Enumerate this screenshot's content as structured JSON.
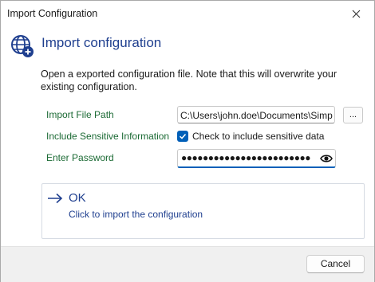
{
  "window": {
    "title": "Import Configuration"
  },
  "header": {
    "title": "Import configuration",
    "icon": "globe-import-icon"
  },
  "description": "Open a exported configuration file. Note that this will overwrite your existing configuration.",
  "form": {
    "path_label": "Import File Path",
    "path_value": "C:\\Users\\john.doe\\Documents\\Simp",
    "browse_label": "...",
    "sensitive_label": "Include Sensitive Information",
    "sensitive_checked": true,
    "sensitive_check_label": "Check to include sensitive data",
    "password_label": "Enter Password",
    "password_value": "●●●●●●●●●●●●●●●●●●●●●●●●"
  },
  "ok_action": {
    "title": "OK",
    "subtitle": "Click to import the configuration"
  },
  "footer": {
    "cancel_label": "Cancel"
  },
  "colors": {
    "accent": "#005fb8",
    "label_green": "#1b6a34",
    "link_blue": "#1f3f8f"
  }
}
